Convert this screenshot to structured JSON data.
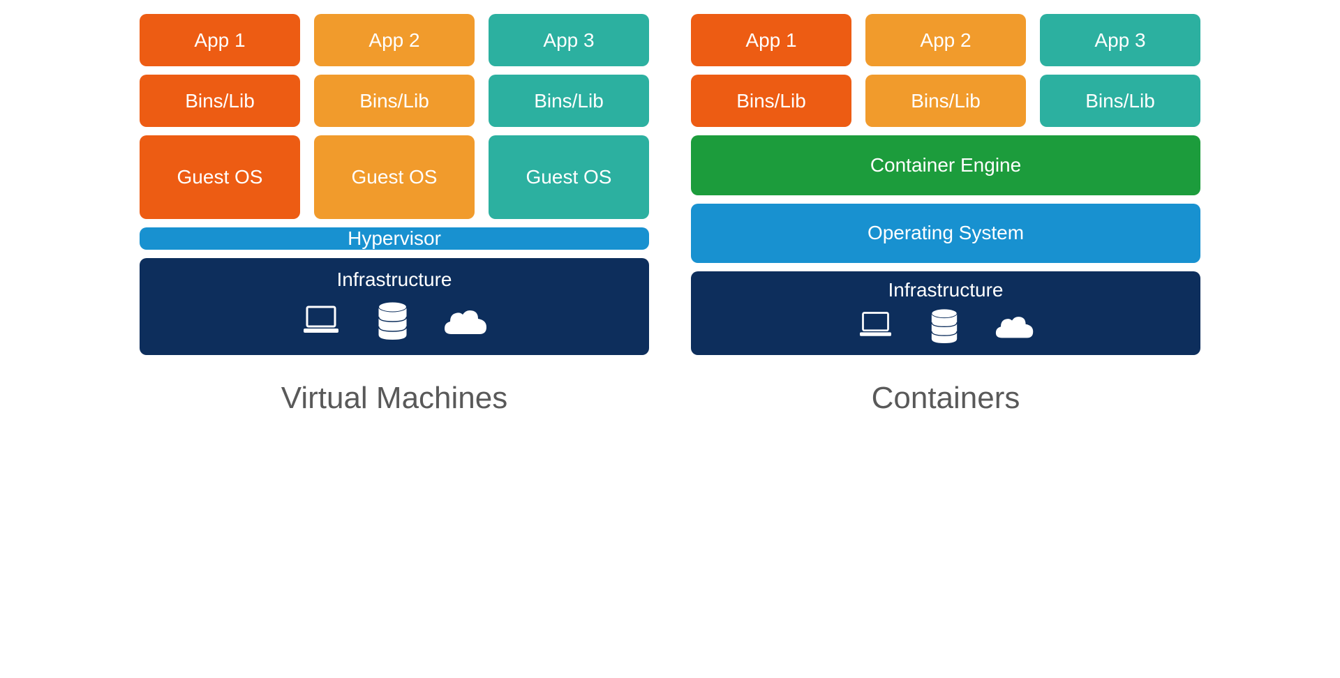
{
  "vm": {
    "title": "Virtual Machines",
    "apps": [
      "App 1",
      "App 2",
      "App 3"
    ],
    "bins": [
      "Bins/Lib",
      "Bins/Lib",
      "Bins/Lib"
    ],
    "guest_os": [
      "Guest OS",
      "Guest OS",
      "Guest OS"
    ],
    "hypervisor": "Hypervisor",
    "infrastructure": "Infrastructure"
  },
  "containers": {
    "title": "Containers",
    "apps": [
      "App 1",
      "App 2",
      "App 3"
    ],
    "bins": [
      "Bins/Lib",
      "Bins/Lib",
      "Bins/Lib"
    ],
    "engine": "Container Engine",
    "os": "Operating System",
    "infrastructure": "Infrastructure"
  },
  "colors": {
    "orange": "#ed5c13",
    "amber": "#f19b2c",
    "teal": "#2cb0a0",
    "green": "#1c9c3c",
    "blue": "#1891d0",
    "navy": "#0d2e5c"
  }
}
